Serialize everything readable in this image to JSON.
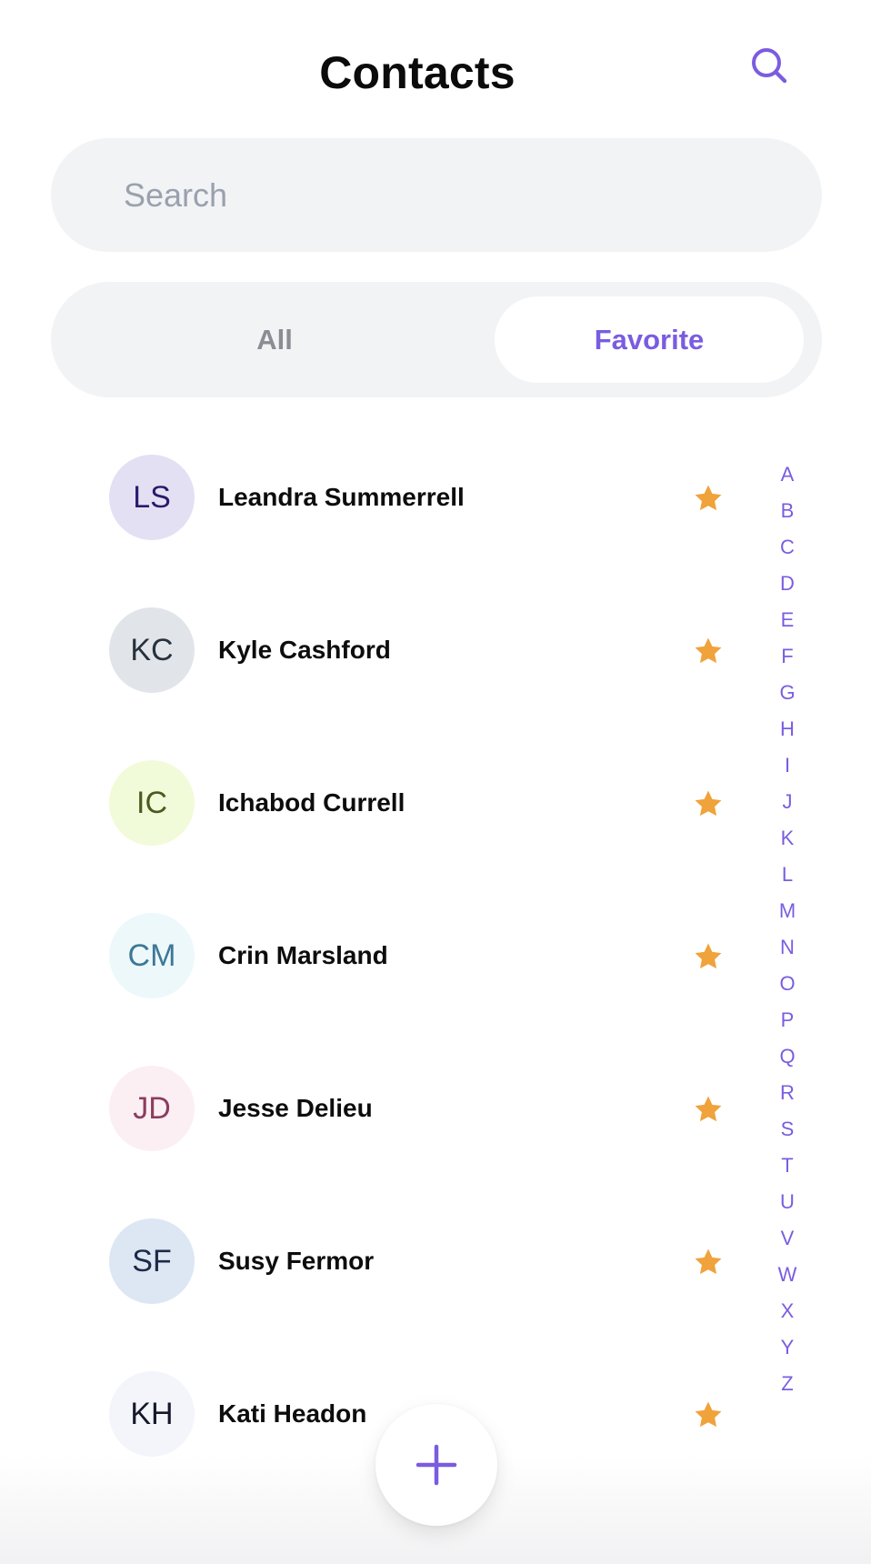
{
  "header": {
    "title": "Contacts",
    "search_icon": "search-icon"
  },
  "search": {
    "placeholder": "Search",
    "value": ""
  },
  "tabs": {
    "all_label": "All",
    "favorite_label": "Favorite",
    "selected": "Favorite"
  },
  "colors": {
    "accent": "#7b5ce0",
    "star": "#f0a23b",
    "field_bg": "#f2f3f5"
  },
  "contacts": [
    {
      "initials": "LS",
      "name": "Leandra Summerrell",
      "favorite": true,
      "avatar_bg": "#e4e0f3",
      "avatar_fg": "#2a1a6b"
    },
    {
      "initials": "KC",
      "name": "Kyle Cashford",
      "favorite": true,
      "avatar_bg": "#e1e5ea",
      "avatar_fg": "#27313c"
    },
    {
      "initials": "IC",
      "name": "Ichabod Currell",
      "favorite": true,
      "avatar_bg": "#f1fbd9",
      "avatar_fg": "#4c5a1f"
    },
    {
      "initials": "CM",
      "name": "Crin Marsland",
      "favorite": true,
      "avatar_bg": "#edf8fb",
      "avatar_fg": "#3d7896"
    },
    {
      "initials": "JD",
      "name": "Jesse Delieu",
      "favorite": true,
      "avatar_bg": "#fbeff4",
      "avatar_fg": "#8c3d5e"
    },
    {
      "initials": "SF",
      "name": "Susy Fermor",
      "favorite": true,
      "avatar_bg": "#dde7f3",
      "avatar_fg": "#1d2a48"
    },
    {
      "initials": "KH",
      "name": "Kati Headon",
      "favorite": true,
      "avatar_bg": "#f4f5fa",
      "avatar_fg": "#14182a"
    }
  ],
  "alphabet": [
    "A",
    "B",
    "C",
    "D",
    "E",
    "F",
    "G",
    "H",
    "I",
    "J",
    "K",
    "L",
    "M",
    "N",
    "O",
    "P",
    "Q",
    "R",
    "S",
    "T",
    "U",
    "V",
    "W",
    "X",
    "Y",
    "Z"
  ],
  "fab": {
    "icon": "plus-icon"
  }
}
